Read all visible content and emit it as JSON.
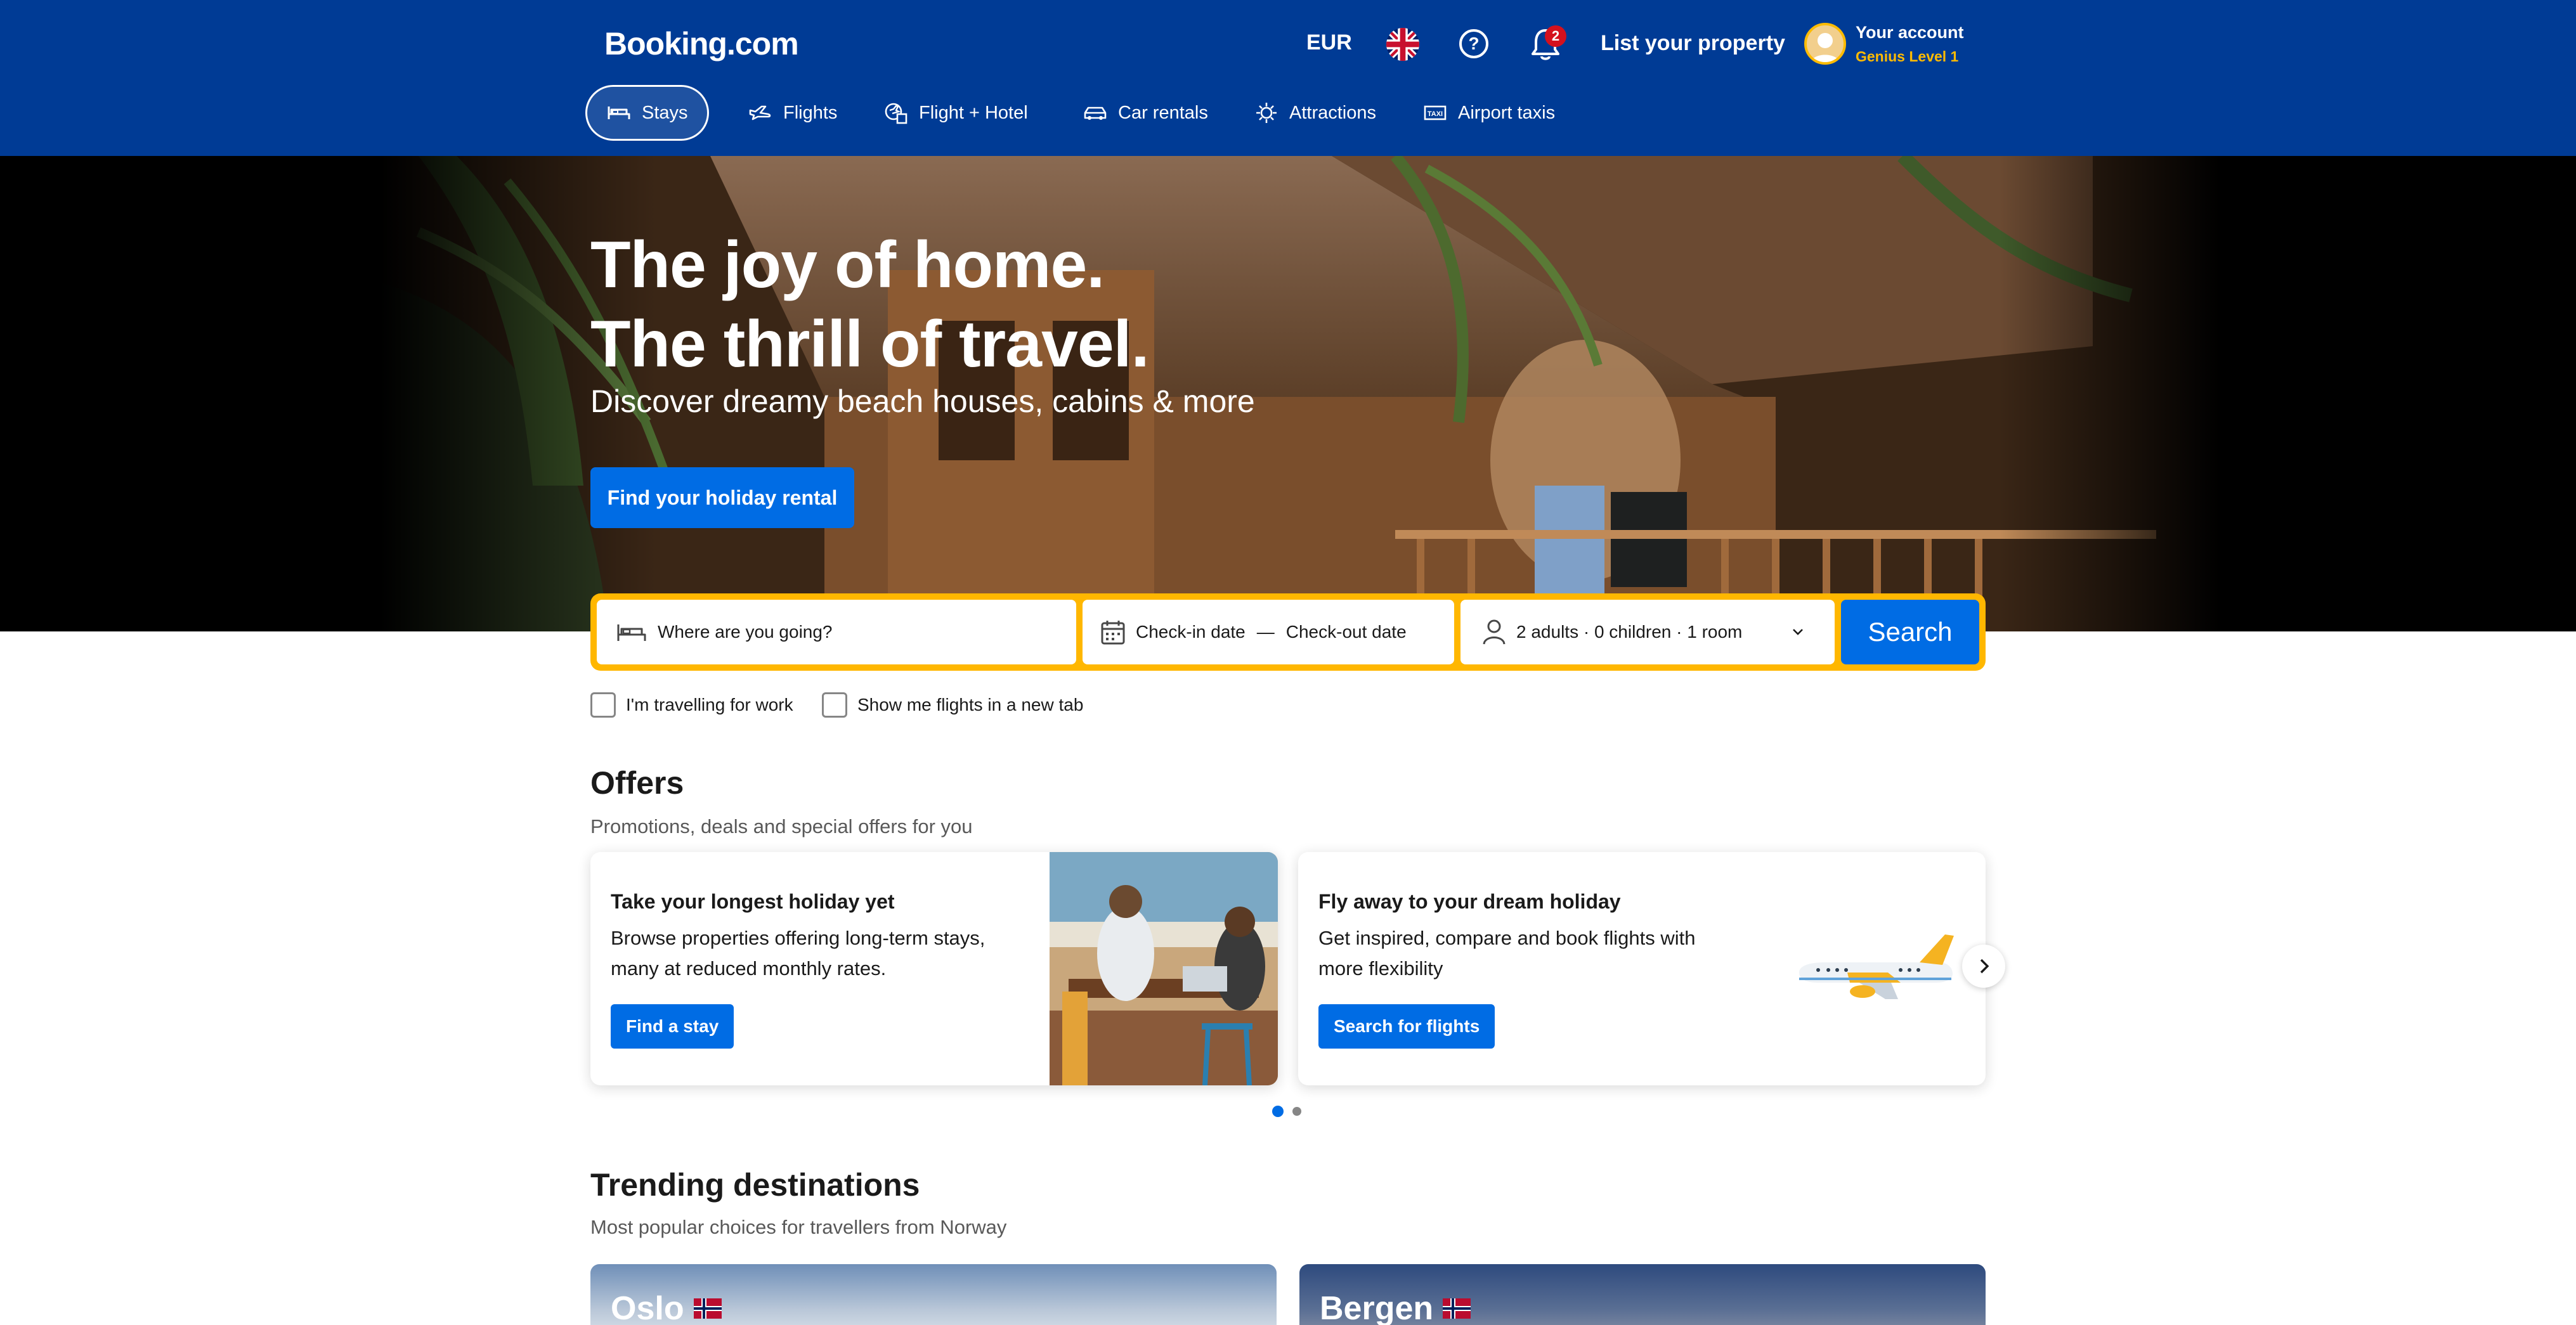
{
  "header": {
    "logo": "Booking.com",
    "currency": "EUR",
    "language_flag_icon": "uk-flag-icon",
    "help_icon": "question-circle-icon",
    "notifications": {
      "icon": "bell-icon",
      "count": "2"
    },
    "list_property": "List your property",
    "account": {
      "name": "Your account",
      "level": "Genius Level 1"
    }
  },
  "nav": {
    "items": [
      {
        "label": "Stays",
        "icon": "bed-icon",
        "active": true
      },
      {
        "label": "Flights",
        "icon": "plane-icon"
      },
      {
        "label": "Flight + Hotel",
        "icon": "flight-hotel-icon"
      },
      {
        "label": "Car rentals",
        "icon": "car-icon"
      },
      {
        "label": "Attractions",
        "icon": "attractions-icon"
      },
      {
        "label": "Airport taxis",
        "icon": "taxi-icon"
      }
    ]
  },
  "hero": {
    "title_line1": "The joy of home.",
    "title_line2": "The thrill of travel.",
    "subtitle": "Discover dreamy beach houses, cabins & more",
    "cta": "Find your holiday rental"
  },
  "search": {
    "destination_placeholder": "Where are you going?",
    "checkin": "Check-in date",
    "date_separator": "—",
    "checkout": "Check-out date",
    "guests": "2 adults · 0 children · 1 room",
    "button": "Search",
    "options": {
      "work": "I'm travelling for work",
      "flights_tab": "Show me flights in a new tab"
    }
  },
  "offers": {
    "title": "Offers",
    "subtitle": "Promotions, deals and special offers for you",
    "cards": [
      {
        "title": "Take your longest holiday yet",
        "text": "Browse properties offering long-term stays, many at reduced monthly rates.",
        "button": "Find a stay"
      },
      {
        "title": "Fly away to your dream holiday",
        "text": "Get inspired, compare and book flights with more flexibility",
        "button": "Search for flights"
      }
    ],
    "pagination": {
      "pages": 2,
      "current": 1
    }
  },
  "trending": {
    "title": "Trending destinations",
    "subtitle": "Most popular choices for travellers from Norway",
    "destinations": [
      {
        "name": "Oslo",
        "flag": "norway-flag-icon"
      },
      {
        "name": "Bergen",
        "flag": "norway-flag-icon"
      }
    ]
  },
  "colors": {
    "brand_blue": "#003b95",
    "action_blue": "#006ce4",
    "search_border": "#ffb700",
    "genius_yellow": "#febb02",
    "badge_red": "#d4111e"
  }
}
